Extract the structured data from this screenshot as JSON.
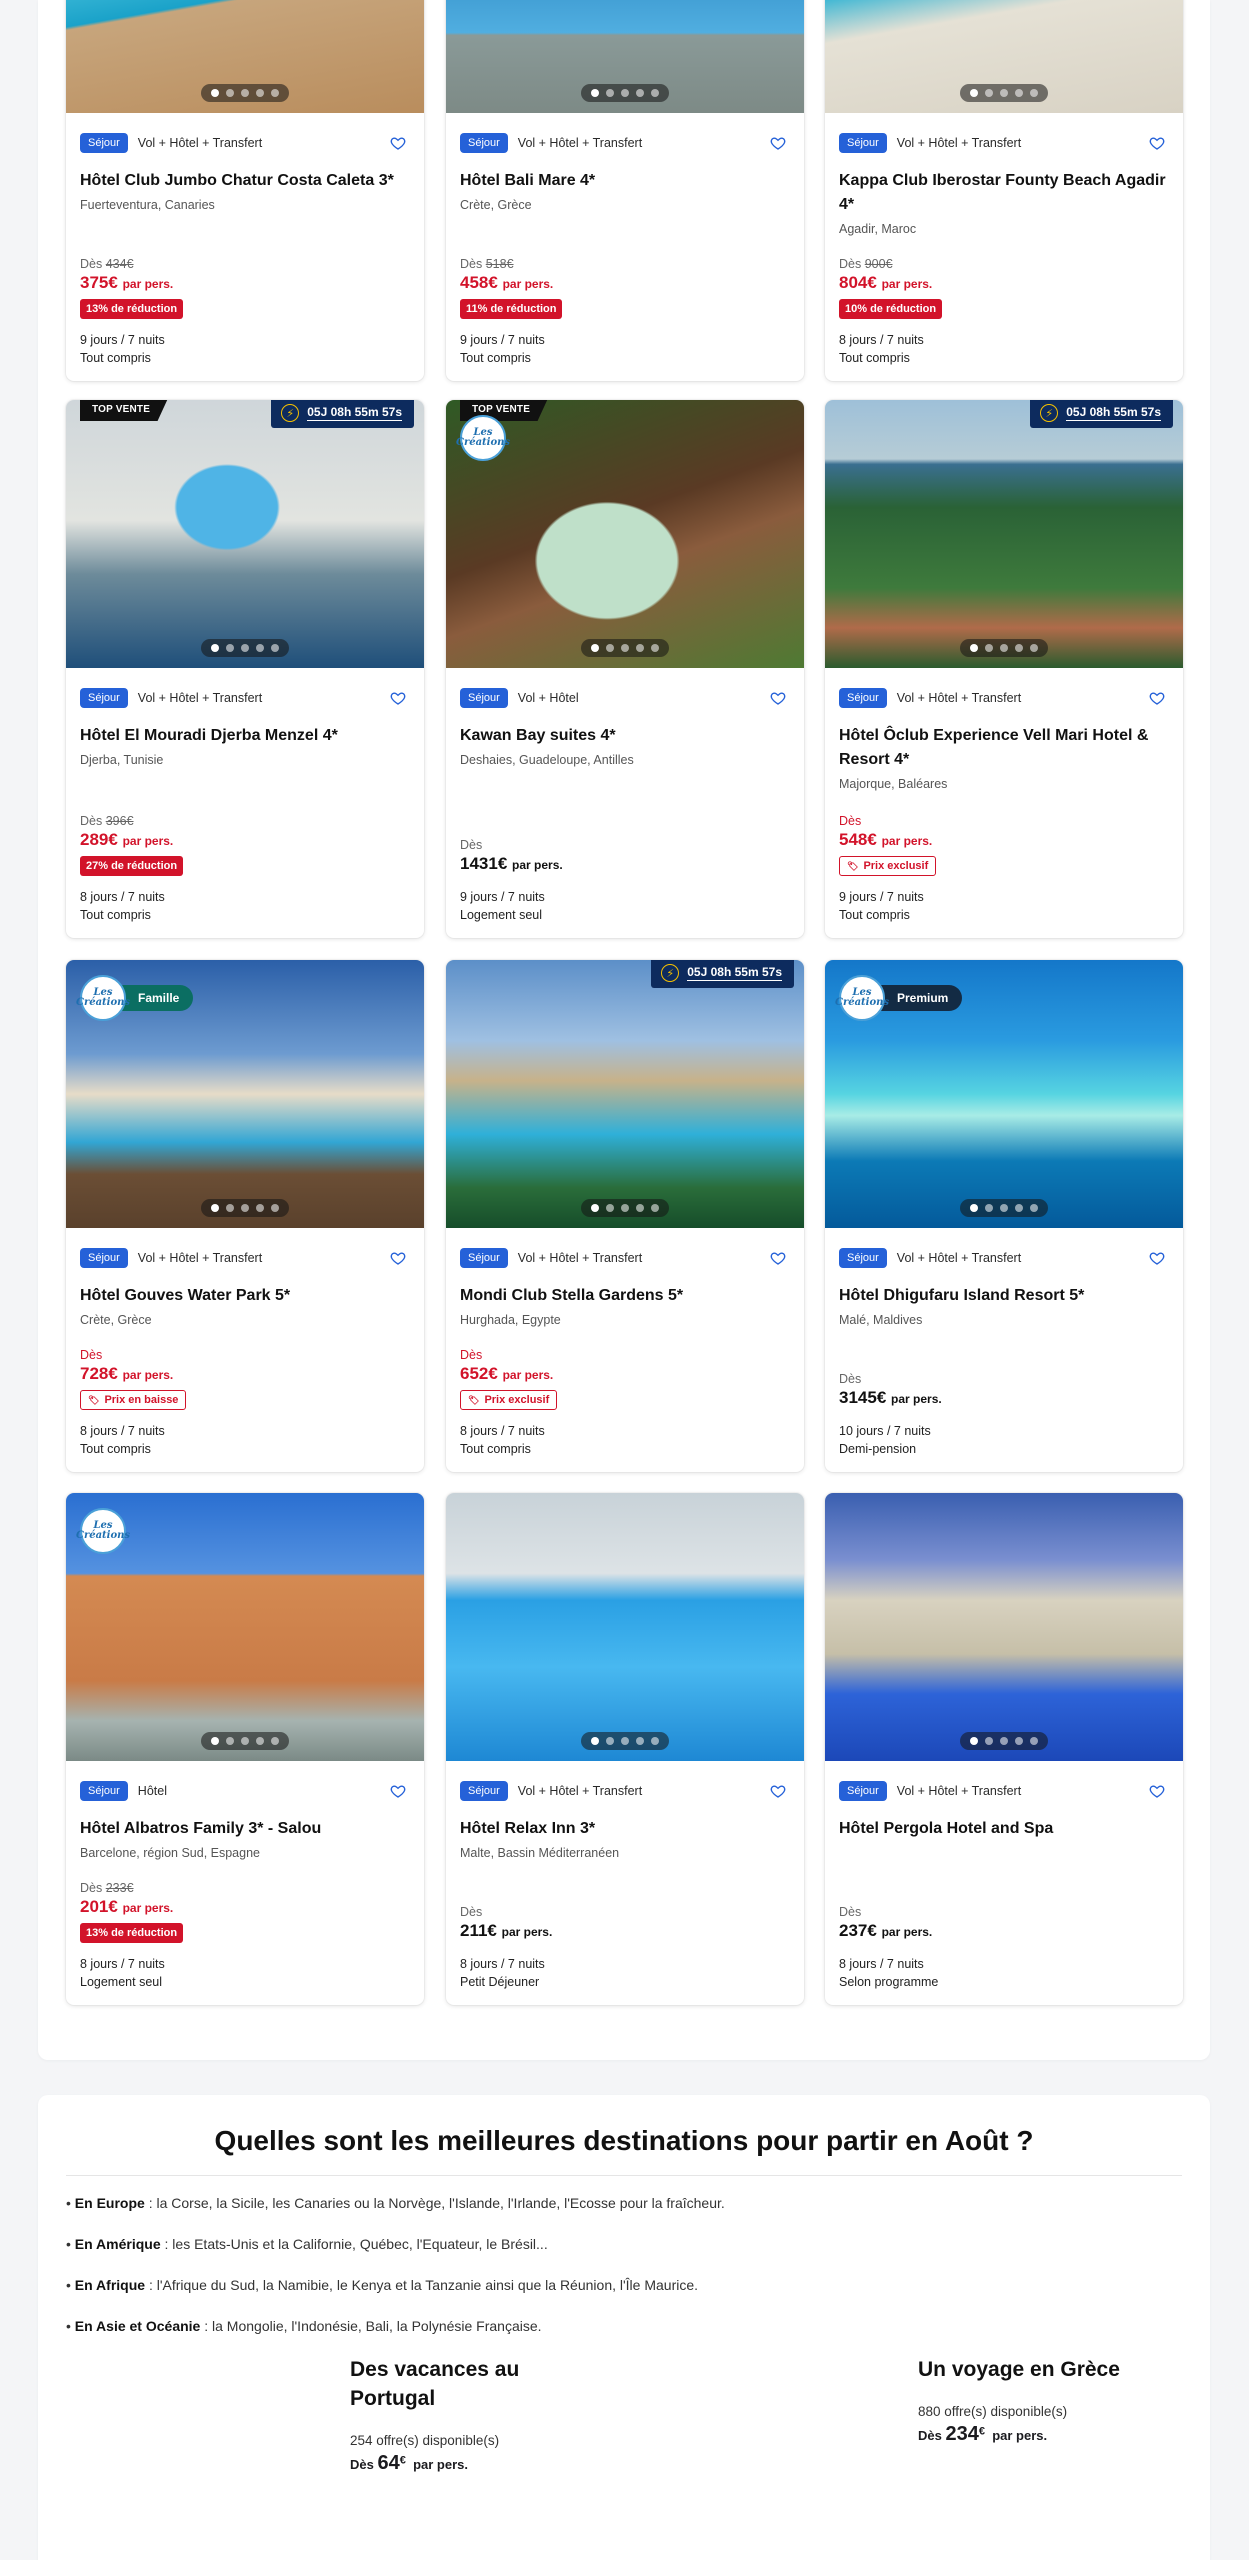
{
  "cards": [
    {
      "tag": "Séjour",
      "type": "Vol + Hôtel + Transfert",
      "title": "Hôtel Club Jumbo Chatur Costa Caleta 3*",
      "location": "Fuerteventura, Canaries",
      "from_label": "Dès",
      "old_price": "434€",
      "price": "375€",
      "per": "par pers.",
      "badge": "13% de réduction",
      "duration": "9 jours / 7 nuits",
      "board": "Tout compris"
    },
    {
      "tag": "Séjour",
      "type": "Vol + Hôtel + Transfert",
      "title": "Hôtel Bali Mare 4*",
      "location": "Crète, Grèce",
      "from_label": "Dès",
      "old_price": "518€",
      "price": "458€",
      "per": "par pers.",
      "badge": "11% de réduction",
      "duration": "9 jours / 7 nuits",
      "board": "Tout compris"
    },
    {
      "tag": "Séjour",
      "type": "Vol + Hôtel + Transfert",
      "title": "Kappa Club Iberostar Founty Beach Agadir 4*",
      "location": "Agadir, Maroc",
      "from_label": "Dès",
      "old_price": "900€",
      "price": "804€",
      "per": "par pers.",
      "badge": "10% de réduction",
      "duration": "8 jours / 7 nuits",
      "board": "Tout compris"
    },
    {
      "ribbon": "TOP VENTE",
      "timer": "05J 08h 55m 57s",
      "tag": "Séjour",
      "type": "Vol + Hôtel + Transfert",
      "title": "Hôtel El Mouradi Djerba Menzel 4*",
      "location": "Djerba, Tunisie",
      "from_label": "Dès",
      "old_price": "396€",
      "price": "289€",
      "per": "par pers.",
      "badge": "27% de réduction",
      "duration": "8 jours / 7 nuits",
      "board": "Tout compris"
    },
    {
      "ribbon": "TOP VENTE",
      "logo": "Les Créations",
      "tag": "Séjour",
      "type": "Vol + Hôtel",
      "title": "Kawan Bay suites 4*",
      "location": "Deshaies, Guadeloupe, Antilles",
      "from_label": "Dès",
      "price": "1431€",
      "per": "par pers.",
      "duration": "9 jours / 7 nuits",
      "board": "Logement seul"
    },
    {
      "timer": "05J 08h 55m 57s",
      "tag": "Séjour",
      "type": "Vol + Hôtel + Transfert",
      "title": "Hôtel Ôclub Experience Vell Mari Hotel & Resort 4*",
      "location": "Majorque, Baléares",
      "from_label": "Dès",
      "price": "548€",
      "per": "par pers.",
      "badge_outline": "Prix exclusif",
      "duration": "9 jours / 7 nuits",
      "board": "Tout compris"
    },
    {
      "logo": "Les Créations",
      "label": "Famille",
      "tag": "Séjour",
      "type": "Vol + Hôtel + Transfert",
      "title": "Hôtel Gouves Water Park 5*",
      "location": "Crète, Grèce",
      "from_label": "Dès",
      "price": "728€",
      "per": "par pers.",
      "badge_outline": "Prix en baisse",
      "duration": "8 jours / 7 nuits",
      "board": "Tout compris"
    },
    {
      "timer": "05J 08h 55m 57s",
      "tag": "Séjour",
      "type": "Vol + Hôtel + Transfert",
      "title": "Mondi Club Stella Gardens 5*",
      "location": "Hurghada, Egypte",
      "from_label": "Dès",
      "price": "652€",
      "per": "par pers.",
      "badge_outline": "Prix exclusif",
      "duration": "8 jours / 7 nuits",
      "board": "Tout compris"
    },
    {
      "logo": "Les Créations",
      "label": "Premium",
      "tag": "Séjour",
      "type": "Vol + Hôtel + Transfert",
      "title": "Hôtel Dhigufaru Island Resort 5*",
      "location": "Malé, Maldives",
      "from_label": "Dès",
      "price": "3145€",
      "per": "par pers.",
      "duration": "10 jours / 7 nuits",
      "board": "Demi-pension"
    },
    {
      "logo": "Les Créations",
      "tag": "Séjour",
      "type": "Hôtel",
      "title": "Hôtel Albatros Family 3* - Salou",
      "location": "Barcelone, région Sud, Espagne",
      "from_label": "Dès",
      "old_price": "233€",
      "price": "201€",
      "per": "par pers.",
      "badge": "13% de réduction",
      "duration": "8 jours / 7 nuits",
      "board": "Logement seul"
    },
    {
      "tag": "Séjour",
      "type": "Vol + Hôtel + Transfert",
      "title": "Hôtel Relax Inn 3*",
      "location": "Malte, Bassin Méditerranéen",
      "from_label": "Dès",
      "price": "211€",
      "per": "par pers.",
      "duration": "8 jours / 7 nuits",
      "board": "Petit Déjeuner"
    },
    {
      "tag": "Séjour",
      "type": "Vol + Hôtel + Transfert",
      "title": "Hôtel Pergola Hotel and Spa",
      "location": "",
      "from_label": "Dès",
      "price": "237€",
      "per": "par pers.",
      "duration": "8 jours / 7 nuits",
      "board": "Selon programme"
    }
  ],
  "destinations": {
    "title": "Quelles sont les meilleures destinations pour partir en Août ?",
    "items": [
      {
        "region": "En Europe",
        "text": " : la Corse, la Sicile, les Canaries ou la Norvège, l'Islande, l'Irlande, l'Ecosse pour la fraîcheur."
      },
      {
        "region": "En Amérique",
        "text": " : les Etats-Unis et la Californie, Québec, l'Equateur, le Brésil..."
      },
      {
        "region": "En Afrique",
        "text": " : l'Afrique du Sud, la Namibie, le Kenya et la Tanzanie ainsi que la Réunion, l'Île Maurice."
      },
      {
        "region": "En Asie et Océanie",
        "text": " : la Mongolie, l'Indonésie, Bali, la Polynésie Française."
      }
    ]
  },
  "promos": [
    {
      "title": "Des vacances au Portugal",
      "offers": "254 offre(s) disponible(s)",
      "from": "Dès",
      "price": "64",
      "currency": "€",
      "per": "par pers."
    },
    {
      "title": "Un voyage en Grèce",
      "offers": "880 offre(s) disponible(s)",
      "from": "Dès",
      "price": "234",
      "currency": "€",
      "per": "par pers."
    }
  ],
  "colors": {
    "accent": "#2561d8",
    "price_red": "#d2132a",
    "timer_bg": "#0d2b5e"
  }
}
